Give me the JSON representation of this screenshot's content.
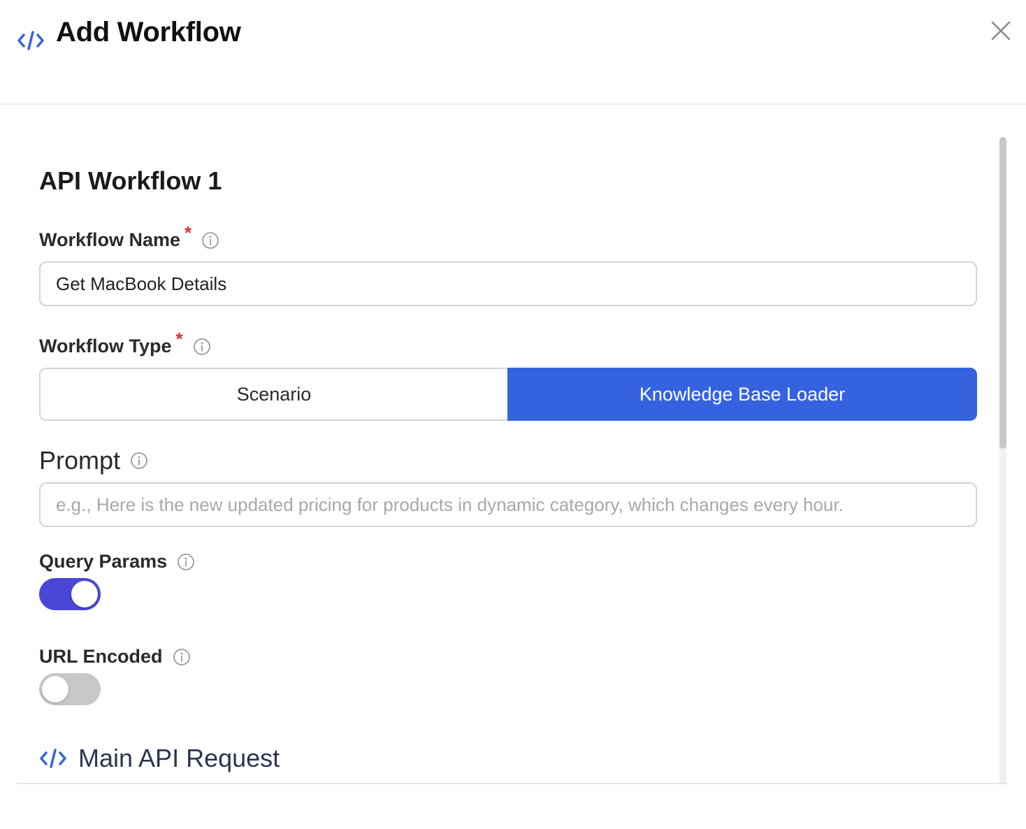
{
  "header": {
    "title": "Add Workflow"
  },
  "section": {
    "title": "API Workflow 1"
  },
  "fields": {
    "workflow_name": {
      "label": "Workflow Name",
      "required_mark": "*",
      "value": "Get MacBook Details"
    },
    "workflow_type": {
      "label": "Workflow Type",
      "required_mark": "*",
      "options": [
        "Scenario",
        "Knowledge Base Loader"
      ],
      "selected": "Knowledge Base Loader"
    },
    "prompt": {
      "label": "Prompt",
      "placeholder": "e.g., Here is the new updated pricing for products in dynamic category, which changes every hour."
    },
    "query_params": {
      "label": "Query Params",
      "enabled": true
    },
    "url_encoded": {
      "label": "URL Encoded",
      "enabled": false
    }
  },
  "main_api": {
    "title": "Main API Request"
  },
  "colors": {
    "accent": "#3563e0",
    "toggle_on": "#4a46d8",
    "required": "#e0342c"
  }
}
